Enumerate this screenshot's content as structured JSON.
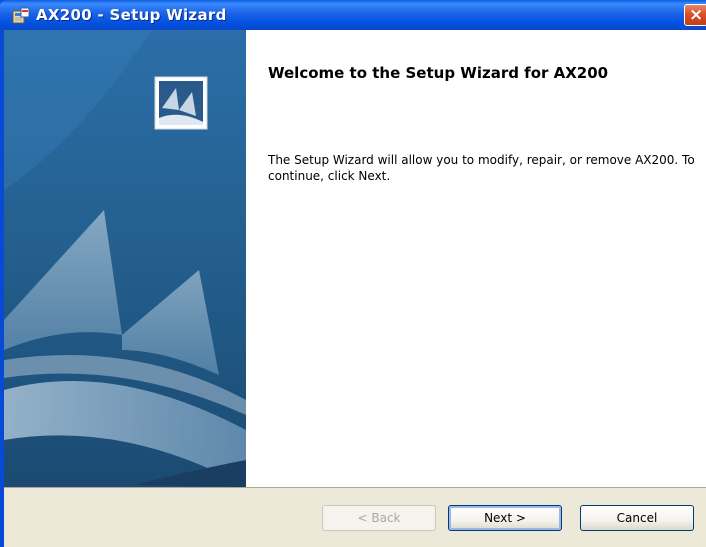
{
  "window": {
    "title": "AX200 - Setup Wizard",
    "close_label": "×"
  },
  "content": {
    "heading": "Welcome to the  Setup Wizard for AX200",
    "description": "The  Setup Wizard will allow you to modify, repair, or remove AX200. To continue, click Next."
  },
  "buttons": {
    "back": "< Back",
    "next": "Next >",
    "cancel": "Cancel"
  },
  "icons": {
    "title_icon": "installer-icon",
    "banner_logo": "setup-logo-icon"
  },
  "colors": {
    "title_bar": "#0a5ce0",
    "banner_blue": "#2a5a8c",
    "close_button": "#d8512a",
    "button_bar": "#ece9d8"
  }
}
